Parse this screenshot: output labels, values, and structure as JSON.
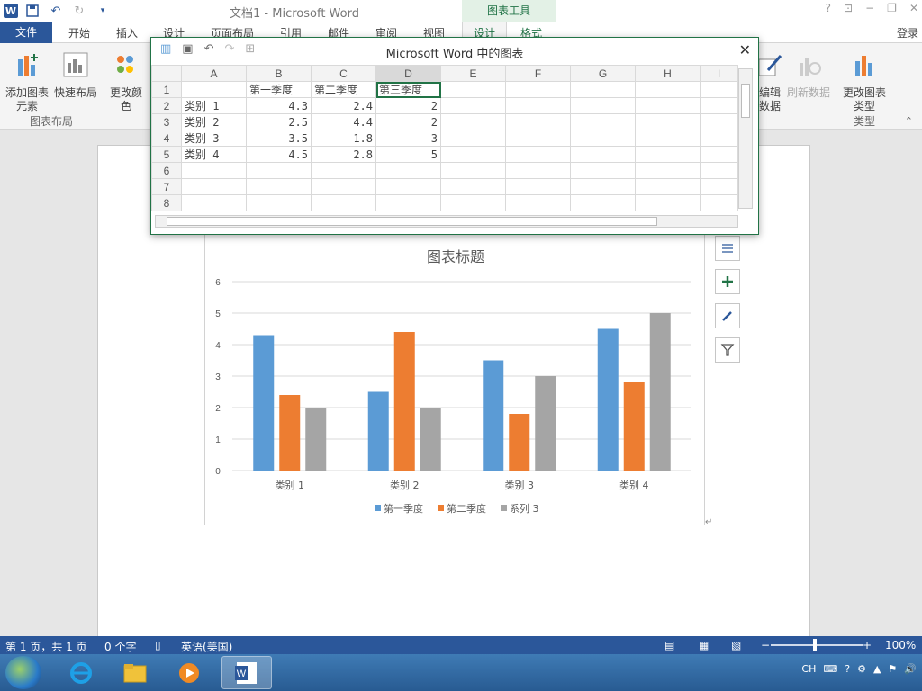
{
  "titlebar": {
    "title": "文档1 - Microsoft Word",
    "context_tool": "图表工具",
    "help": "?",
    "minimize": "−",
    "restore": "❐",
    "close": "✕"
  },
  "tabs": {
    "file": "文件",
    "items": [
      "开始",
      "插入",
      "设计",
      "页面布局",
      "引用",
      "邮件",
      "审阅",
      "视图"
    ],
    "ctx_design": "设计",
    "ctx_format": "格式",
    "login": "登录"
  },
  "ribbon": {
    "add_element": "添加图表元素",
    "quick_layout": "快速布局",
    "change_color": "更改颜色",
    "group_layout": "图表布局",
    "edit_data": "编辑数据",
    "refresh_data": "刷新数据",
    "change_type": "更改图表类型",
    "group_type": "类型"
  },
  "sheet": {
    "title": "Microsoft Word 中的图表",
    "columns": [
      "A",
      "B",
      "C",
      "D",
      "E",
      "F",
      "G",
      "H",
      "I"
    ],
    "rows": [
      [
        "1",
        "",
        "第一季度",
        "第二季度",
        "第三季度",
        "",
        "",
        "",
        "",
        ""
      ],
      [
        "2",
        "类别 1",
        "4.3",
        "2.4",
        "2",
        "",
        "",
        "",
        "",
        ""
      ],
      [
        "3",
        "类别 2",
        "2.5",
        "4.4",
        "2",
        "",
        "",
        "",
        "",
        ""
      ],
      [
        "4",
        "类别 3",
        "3.5",
        "1.8",
        "3",
        "",
        "",
        "",
        "",
        ""
      ],
      [
        "5",
        "类别 4",
        "4.5",
        "2.8",
        "5",
        "",
        "",
        "",
        "",
        ""
      ],
      [
        "6",
        "",
        "",
        "",
        "",
        "",
        "",
        "",
        "",
        ""
      ],
      [
        "7",
        "",
        "",
        "",
        "",
        "",
        "",
        "",
        "",
        ""
      ],
      [
        "8",
        "",
        "",
        "",
        "",
        "",
        "",
        "",
        "",
        ""
      ]
    ]
  },
  "chart_data": {
    "type": "bar",
    "title": "图表标题",
    "categories": [
      "类别 1",
      "类别 2",
      "类别 3",
      "类别 4"
    ],
    "series": [
      {
        "name": "第一季度",
        "values": [
          4.3,
          2.5,
          3.5,
          4.5
        ],
        "color": "#5b9bd5"
      },
      {
        "name": "第二季度",
        "values": [
          2.4,
          4.4,
          1.8,
          2.8
        ],
        "color": "#ed7d31"
      },
      {
        "name": "系列 3",
        "values": [
          2,
          2,
          3,
          5
        ],
        "color": "#a5a5a5"
      }
    ],
    "yticks": [
      "0",
      "1",
      "2",
      "3",
      "4",
      "5",
      "6"
    ],
    "ylim": [
      0,
      6
    ],
    "grid": true,
    "legend": "bottom"
  },
  "statusbar": {
    "page": "第 1 页，共 1 页",
    "words": "0 个字",
    "lang": "英语(美国)",
    "zoom": "100%"
  },
  "tray": {
    "ime": "CH"
  }
}
